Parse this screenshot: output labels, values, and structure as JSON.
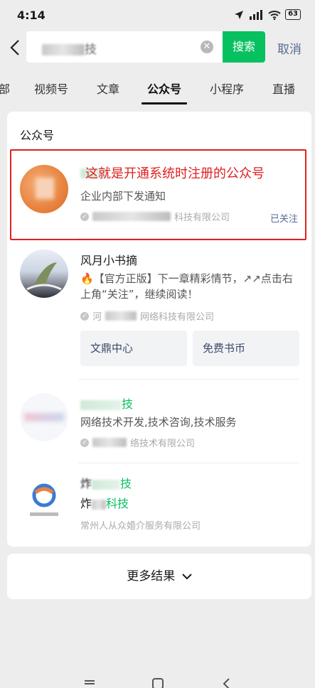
{
  "status": {
    "time": "4:14",
    "battery": "63"
  },
  "search": {
    "query_visible": "技",
    "search_button": "搜索",
    "cancel": "取消"
  },
  "tabs": [
    "部",
    "视频号",
    "文章",
    "公众号",
    "小程序",
    "直播"
  ],
  "section_title": "公众号",
  "annotation": "这就是开通系统时注册的公众号",
  "results": [
    {
      "desc": "企业内部下发通知",
      "company_suffix": "科技有限公司",
      "follow_status": "已关注"
    },
    {
      "name": "风月小书摘",
      "desc": "🔥【官方正版】下一章精彩情节，↗↗点击右上角“关注”，继续阅读！",
      "company_prefix": "河",
      "company_suffix": "网络科技有限公司",
      "buttons": [
        "文鼎中心",
        "免费书币"
      ]
    },
    {
      "name_suffix": "技",
      "desc": "网络技术开发,技术咨询,技术服务",
      "company_suffix": "络技术有限公司"
    },
    {
      "name_suffix": "技",
      "name2_prefix": "炸",
      "name2_suffix": "科技",
      "company": "常州人从众婚介服务有限公司"
    }
  ],
  "more_results": "更多结果"
}
